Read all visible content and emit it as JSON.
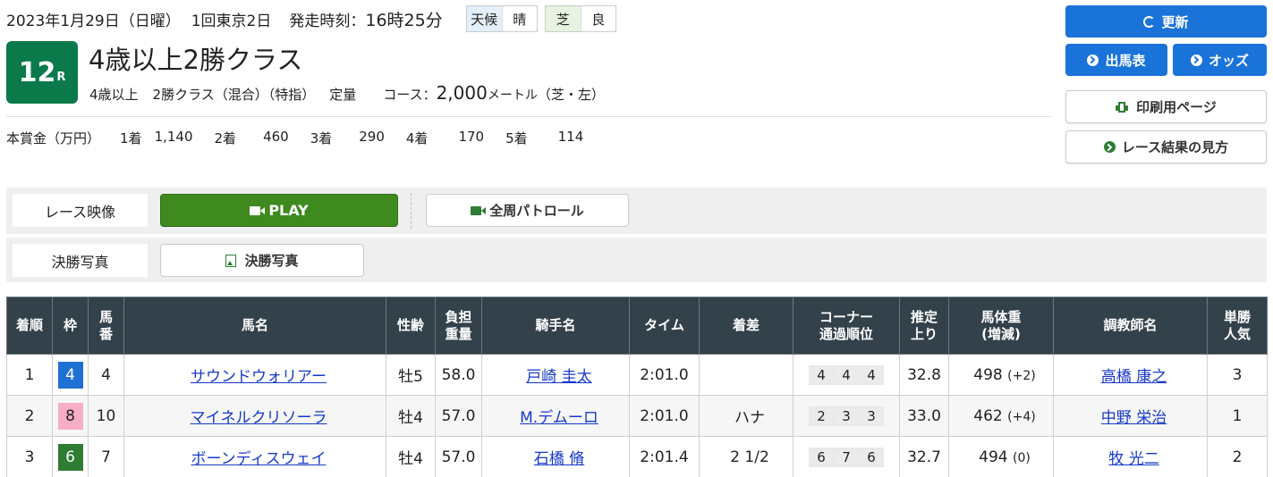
{
  "header": {
    "date": "2023年1月29日（日曜）",
    "meeting": "1回東京2日",
    "start_label": "発走時刻：",
    "start_time": "16時25分",
    "weather_label": "天候",
    "weather": "晴",
    "track_label": "芝",
    "track_cond": "良"
  },
  "race": {
    "number": "12",
    "r_suffix": "R",
    "name": "4歳以上2勝クラス",
    "age": "4歳以上",
    "class": "2勝クラス（混合）（特指）",
    "weight_type": "定量",
    "course_label": "コース：",
    "distance": "2,000",
    "unit": "メートル",
    "course_detail": "（芝・左）"
  },
  "prize": {
    "label": "本賞金（万円）",
    "items": [
      {
        "place": "1着",
        "amount": "1,140"
      },
      {
        "place": "2着",
        "amount": "460"
      },
      {
        "place": "3着",
        "amount": "290"
      },
      {
        "place": "4着",
        "amount": "170"
      },
      {
        "place": "5着",
        "amount": "114"
      }
    ]
  },
  "side_buttons": {
    "refresh": "更新",
    "entries": "出馬表",
    "odds": "オッズ",
    "print": "印刷用ページ",
    "guide": "レース結果の見方"
  },
  "media": {
    "video_label": "レース映像",
    "play": "PLAY",
    "patrol": "全周パトロール",
    "photo_label": "決勝写真",
    "photo_btn": "決勝写真"
  },
  "colors": {
    "accent_blue": "#1a73d9",
    "race_green": "#0b7a4a",
    "play_green": "#3e8a1f",
    "header_dark": "#33414a"
  },
  "table": {
    "headers": [
      "着順",
      "枠",
      "馬番",
      "馬名",
      "性齢",
      "負担重量",
      "騎手名",
      "タイム",
      "着差",
      "コーナー通過順位",
      "推定上り",
      "馬体重(増減)",
      "調教師名",
      "単勝人気"
    ],
    "rows": [
      {
        "place": "1",
        "waku": "4",
        "umaban": "4",
        "horse": "サウンドウォリアー",
        "sexage": "牡5",
        "weight": "58.0",
        "jockey": "戸崎 圭太",
        "time": "2:01.0",
        "margin": "",
        "corners": [
          "4",
          "4",
          "4"
        ],
        "last3f": "32.8",
        "bw": "498",
        "bwdiff": "(+2)",
        "trainer": "高橋 康之",
        "pop": "3"
      },
      {
        "place": "2",
        "waku": "8",
        "umaban": "10",
        "horse": "マイネルクリソーラ",
        "sexage": "牡4",
        "weight": "57.0",
        "jockey": "M.デムーロ",
        "time": "2:01.0",
        "margin": "ハナ",
        "corners": [
          "2",
          "3",
          "3"
        ],
        "last3f": "33.0",
        "bw": "462",
        "bwdiff": "(+4)",
        "trainer": "中野 栄治",
        "pop": "1"
      },
      {
        "place": "3",
        "waku": "6",
        "umaban": "7",
        "horse": "ボーンディスウェイ",
        "sexage": "牡4",
        "weight": "57.0",
        "jockey": "石橋 脩",
        "time": "2:01.4",
        "margin": "2 1/2",
        "corners": [
          "6",
          "7",
          "6"
        ],
        "last3f": "32.7",
        "bw": "494",
        "bwdiff": "(0)",
        "trainer": "牧 光二",
        "pop": "2"
      }
    ]
  }
}
